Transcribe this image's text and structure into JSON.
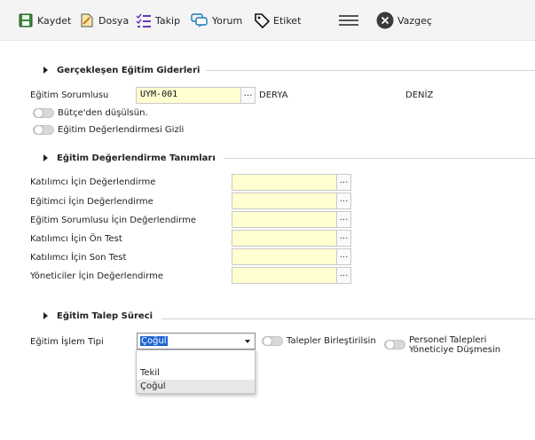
{
  "toolbar": {
    "save": "Kaydet",
    "file": "Dosya",
    "follow": "Takip",
    "comment": "Yorum",
    "tag": "Etiket",
    "cancel": "Vazgeç"
  },
  "section1": {
    "title": "Gerçekleşen Eğitim Giderleri",
    "responsible_label": "Eğitim Sorumlusu",
    "responsible_code": "UYM-001",
    "responsible_first": "DERYA",
    "responsible_last": "DENİZ",
    "budget_toggle": "Bütçe'den düşülsün.",
    "hidden_toggle": "Eğitim Değerlendirmesi Gizli"
  },
  "section2": {
    "title": "Eğitim Değerlendirme Tanımları",
    "rows": [
      {
        "label": "Katılımcı İçin Değerlendirme",
        "value": ""
      },
      {
        "label": "Eğitimci İçin Değerlendirme",
        "value": ""
      },
      {
        "label": "Eğitim Sorumlusu İçin Değerlendirme",
        "value": ""
      },
      {
        "label": "Katılımcı İçin Ön Test",
        "value": ""
      },
      {
        "label": "Katılımcı İçin Son Test",
        "value": ""
      },
      {
        "label": "Yöneticiler İçin Değerlendirme",
        "value": ""
      }
    ]
  },
  "section3": {
    "title": "Eğitim Talep Süreci",
    "process_label": "Eğitim İşlem Tipi",
    "process_value": "Çoğul",
    "options": [
      "",
      "Tekil",
      "Çoğul"
    ],
    "merge_toggle": "Talepler Birleştirilsin",
    "manager_toggle_line1": "Personel Talepleri",
    "manager_toggle_line2": "Yöneticiye Düşmesin"
  },
  "lookup_dots": "..."
}
